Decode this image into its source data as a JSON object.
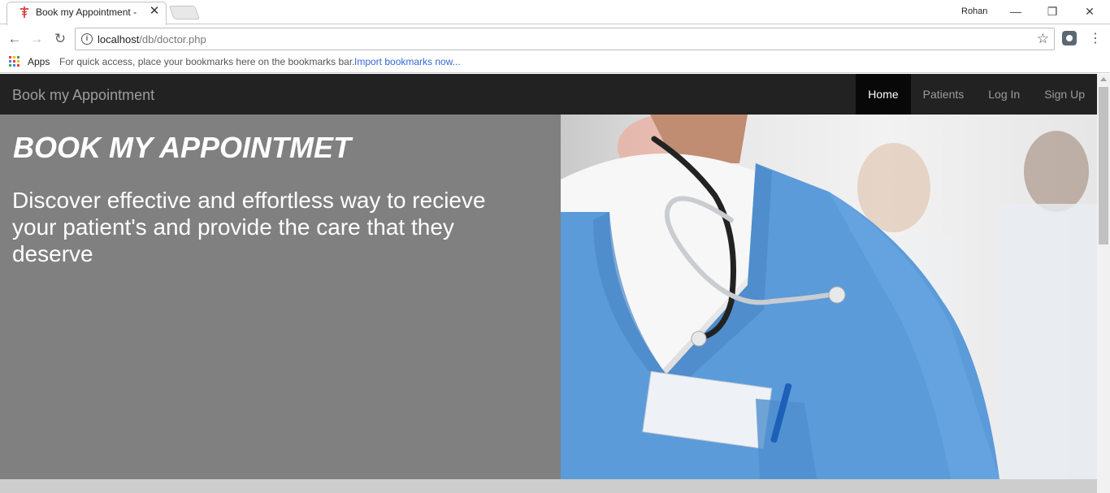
{
  "browser": {
    "tab_title": "Book my Appointment -",
    "tab_close": "✕",
    "profile_name": "Rohan",
    "url_host": "localhost",
    "url_path": "/db/doctor.php",
    "apps_label": "Apps",
    "bookmarks_hint": "For quick access, place your bookmarks here on the bookmarks bar.",
    "bookmarks_link": "Import bookmarks now..."
  },
  "navbar": {
    "brand": "Book my Appointment",
    "items": [
      {
        "label": "Home",
        "active": true
      },
      {
        "label": "Patients",
        "active": false
      },
      {
        "label": "Log In",
        "active": false
      },
      {
        "label": "Sign Up",
        "active": false
      }
    ]
  },
  "hero": {
    "title": "BOOK MY APPOINTMET",
    "text": "Discover effective and effortless way to recieve your patient's and provide the care that they deserve",
    "image": "doctor-in-blue-scrubs-with-stethoscope"
  },
  "colors": {
    "navbar_bg": "#222222",
    "hero_left_bg": "#808080",
    "scrubs_blue": "#5b9bd9",
    "link_blue": "#3367d6"
  }
}
